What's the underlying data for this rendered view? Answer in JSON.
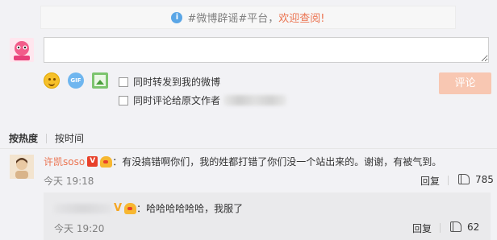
{
  "notice": {
    "prefix": "#微博辟谣#平台，",
    "link": "欢迎查阅!"
  },
  "composer": {
    "placeholder": "",
    "forward_label": "同时转发到我的微博",
    "comment_original_label": "同时评论给原文作者",
    "submit_label": "评论"
  },
  "sort": {
    "by_hot": "按热度",
    "by_time": "按时间"
  },
  "comments": [
    {
      "username": "许凯soso",
      "vip_badge": "V",
      "text": "：有没搞错啊你们，我的姓都打错了你们没一个站出来的。谢谢，有被气到。",
      "time": "今天 19:18",
      "reply_label": "回复",
      "likes": "785"
    }
  ],
  "sub_reply": {
    "vip_badge": "V",
    "text": "：哈哈哈哈哈哈，我服了",
    "time": "今天 19:20",
    "reply_label": "回复",
    "likes": "62"
  },
  "colors": {
    "accent": "#eb7350",
    "submit_disabled": "#f8c7b2",
    "notice_icon": "#5aa6e6"
  },
  "icons": [
    "info-icon",
    "emoji-icon",
    "gif-icon",
    "image-icon",
    "like-icon"
  ]
}
